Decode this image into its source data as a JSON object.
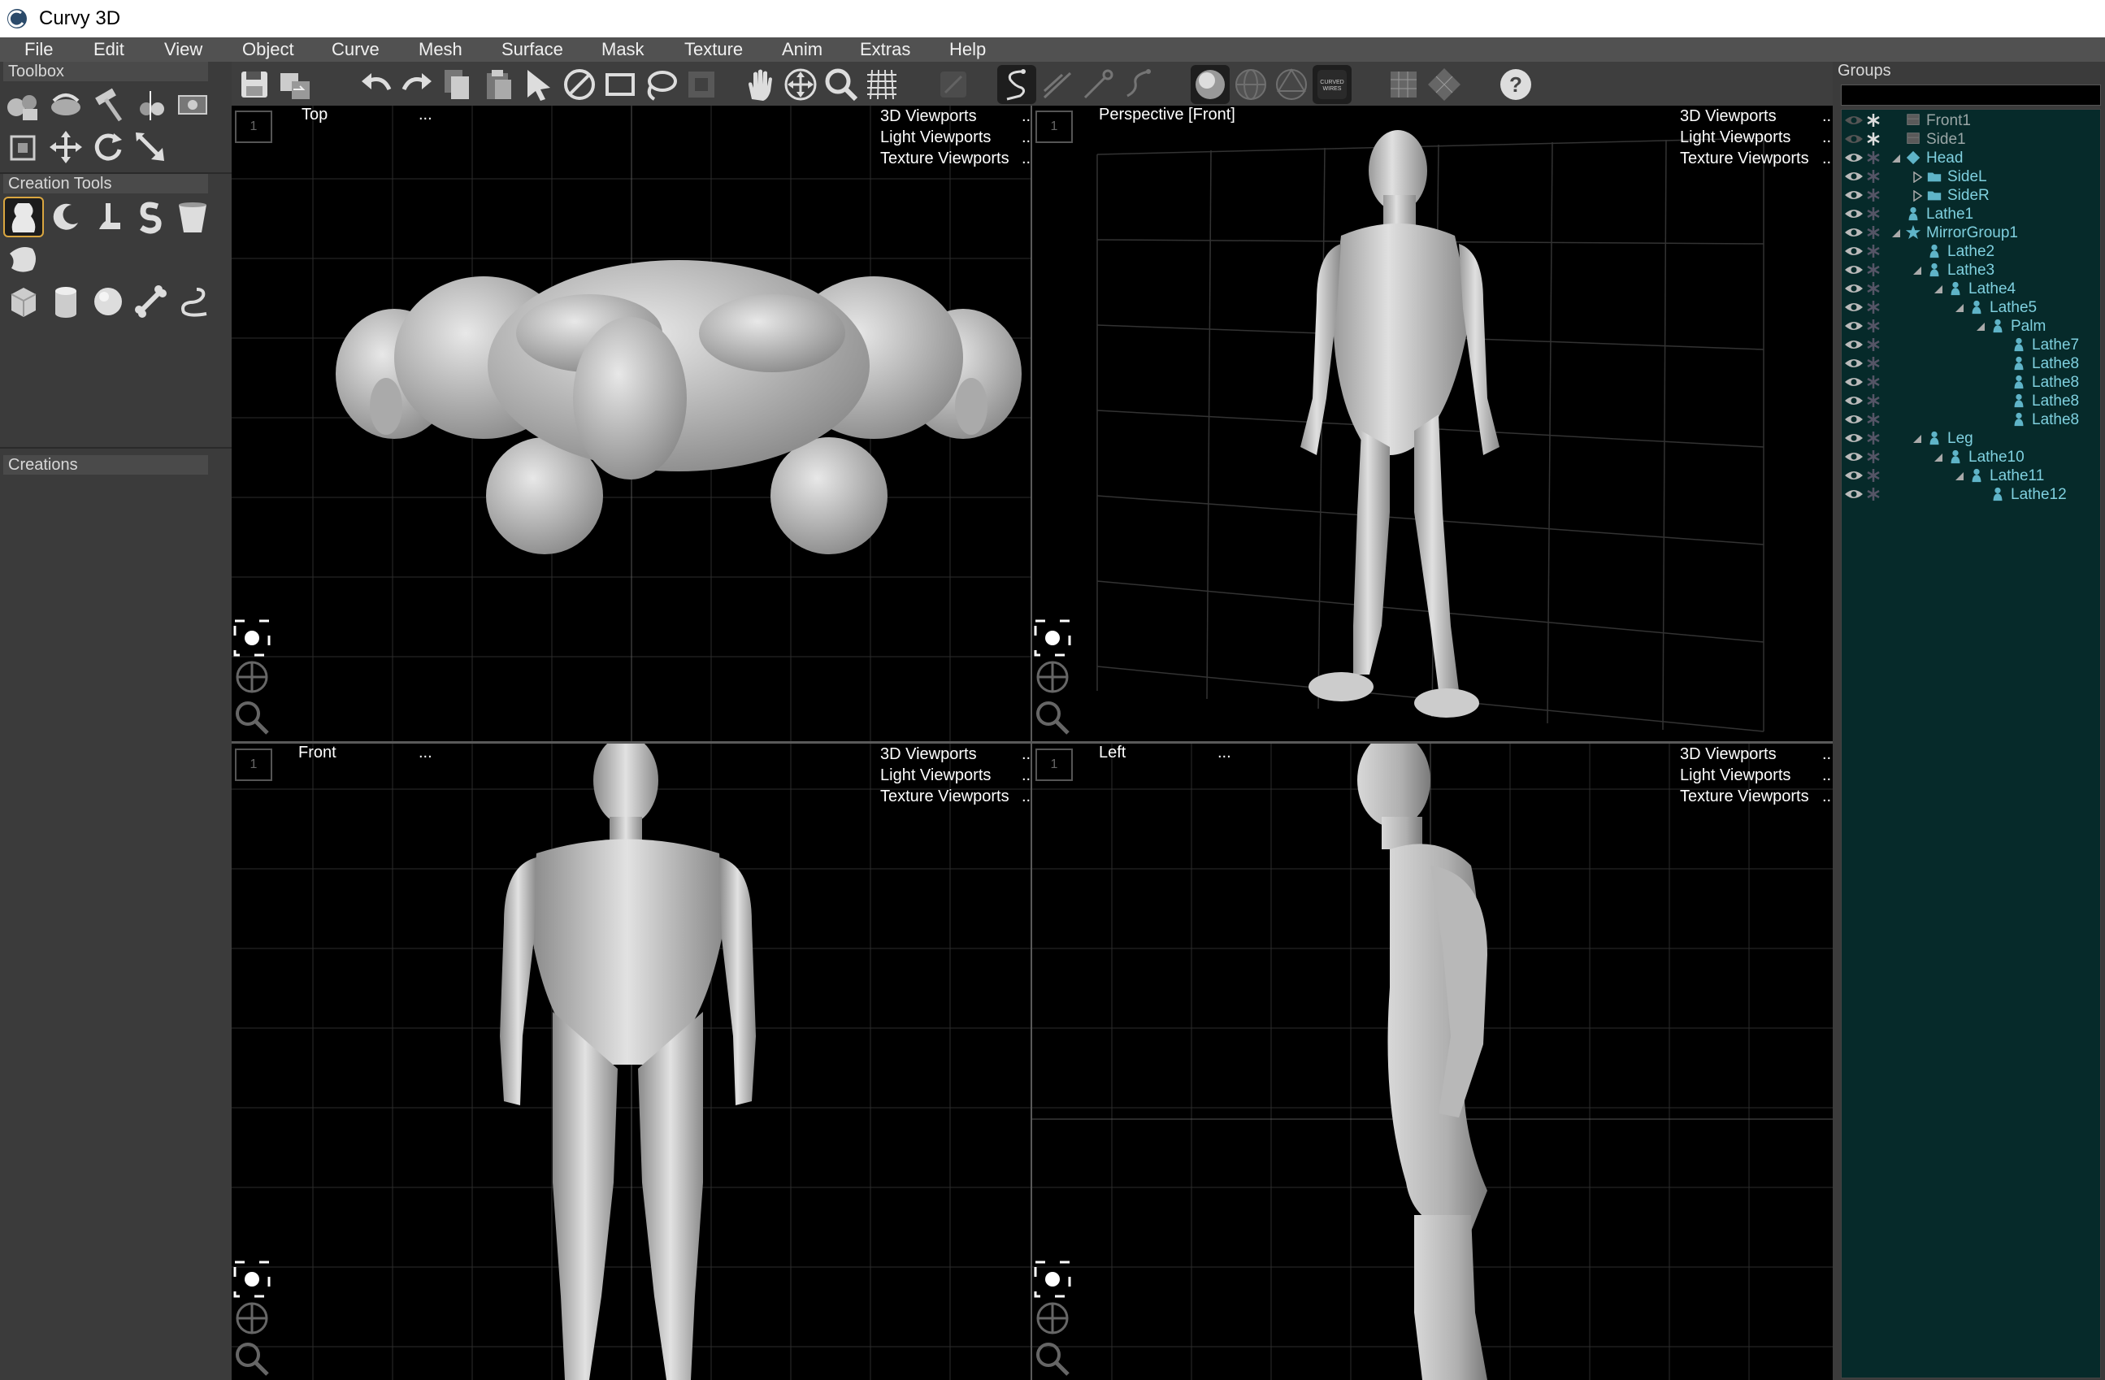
{
  "app": {
    "title": "Curvy 3D",
    "accent": "#d9a640",
    "tree_text_color": "#7fd0df",
    "tree_bg": "#062a2a"
  },
  "menu": [
    "File",
    "Edit",
    "View",
    "Object",
    "Curve",
    "Mesh",
    "Surface",
    "Mask",
    "Texture",
    "Anim",
    "Extras",
    "Help"
  ],
  "toolbar": {
    "icons": [
      "save-icon",
      "save-as-icon",
      "undo-icon",
      "redo-icon",
      "copy-icon",
      "paste-icon",
      "select-icon",
      "deselect-icon",
      "rectangle-select-icon",
      "lasso-icon",
      "select-mask-icon",
      "pan-icon",
      "move-icon",
      "zoom-icon",
      "grid-icon",
      "draw-disabled-icon",
      "curve-pen-icon",
      "curve-straight-icon",
      "curve-point-icon",
      "curve-edit-icon",
      "shaded-sphere-icon",
      "wire-sphere-icon",
      "wire-sphere-alt-icon",
      "curved-wires-icon",
      "flat-view-icon",
      "diamond-view-icon",
      "help-icon"
    ],
    "curved_wires_label": "CURVED WIRES"
  },
  "left_panel": {
    "toolbox_title": "Toolbox",
    "creation_tools_title": "Creation Tools",
    "creations_title": "Creations",
    "toolbox_icons": [
      "shapes-icon",
      "morph-icon",
      "sculpt-hammer-icon",
      "split-icon",
      "image-plane-icon",
      "cube-transform-icon",
      "move-arrows-icon",
      "rotate-icon",
      "scale-icon"
    ],
    "creation_icons": [
      "lathe-tool-icon",
      "crescent-tool-icon",
      "extrude-tool-icon",
      "spiral-s-tool-icon",
      "cup-tool-icon",
      "flat-patch-tool-icon",
      "cube-tool-icon",
      "cylinder-tool-icon",
      "sphere-tool-icon",
      "bone-tool-icon",
      "tube-tool-icon"
    ]
  },
  "viewports": [
    {
      "name": "Top",
      "dots": "...",
      "menu": [
        "3D Viewports",
        "Light Viewports",
        "Texture Viewports"
      ],
      "number": "1"
    },
    {
      "name": "Perspective [Front]",
      "dots": "",
      "menu": [
        "3D Viewports",
        "Light Viewports",
        "Texture Viewports"
      ],
      "number": "1"
    },
    {
      "name": "Front",
      "dots": "...",
      "menu": [
        "3D Viewports",
        "Light Viewports",
        "Texture Viewports"
      ],
      "number": "1"
    },
    {
      "name": "Left",
      "dots": "...",
      "menu": [
        "3D Viewports",
        "Light Viewports",
        "Texture Viewports"
      ],
      "number": "1"
    }
  ],
  "viewport_menu_ellipsis": "..",
  "groups": {
    "title": "Groups",
    "items": [
      {
        "label": "Front1",
        "depth": 0,
        "icon": "image-plane",
        "expander": "none",
        "grey": true
      },
      {
        "label": "Side1",
        "depth": 0,
        "icon": "image-plane",
        "expander": "none",
        "grey": true
      },
      {
        "label": "Head",
        "depth": 0,
        "icon": "diamond",
        "expander": "open",
        "grey": false
      },
      {
        "label": "SideL",
        "depth": 1,
        "icon": "folder",
        "expander": "closed",
        "grey": false
      },
      {
        "label": "SideR",
        "depth": 1,
        "icon": "folder",
        "expander": "closed",
        "grey": false
      },
      {
        "label": "Lathe1",
        "depth": 0,
        "icon": "lathe",
        "expander": "none",
        "grey": false
      },
      {
        "label": "MirrorGroup1",
        "depth": 0,
        "icon": "star",
        "expander": "open",
        "grey": false
      },
      {
        "label": "Lathe2",
        "depth": 1,
        "icon": "lathe",
        "expander": "none",
        "grey": false
      },
      {
        "label": "Lathe3",
        "depth": 1,
        "icon": "lathe",
        "expander": "open",
        "grey": false
      },
      {
        "label": "Lathe4",
        "depth": 2,
        "icon": "lathe",
        "expander": "open",
        "grey": false
      },
      {
        "label": "Lathe5",
        "depth": 3,
        "icon": "lathe",
        "expander": "open",
        "grey": false
      },
      {
        "label": "Palm",
        "depth": 4,
        "icon": "lathe",
        "expander": "open",
        "grey": false
      },
      {
        "label": "Lathe7",
        "depth": 5,
        "icon": "lathe",
        "expander": "none",
        "grey": false
      },
      {
        "label": "Lathe8",
        "depth": 5,
        "icon": "lathe",
        "expander": "none",
        "grey": false
      },
      {
        "label": "Lathe8",
        "depth": 5,
        "icon": "lathe",
        "expander": "none",
        "grey": false
      },
      {
        "label": "Lathe8",
        "depth": 5,
        "icon": "lathe",
        "expander": "none",
        "grey": false
      },
      {
        "label": "Lathe8",
        "depth": 5,
        "icon": "lathe",
        "expander": "none",
        "grey": false
      },
      {
        "label": "Leg",
        "depth": 1,
        "icon": "lathe",
        "expander": "open",
        "grey": false
      },
      {
        "label": "Lathe10",
        "depth": 2,
        "icon": "lathe",
        "expander": "open",
        "grey": false
      },
      {
        "label": "Lathe11",
        "depth": 3,
        "icon": "lathe",
        "expander": "open",
        "grey": false
      },
      {
        "label": "Lathe12",
        "depth": 4,
        "icon": "lathe",
        "expander": "none",
        "grey": false
      }
    ]
  }
}
